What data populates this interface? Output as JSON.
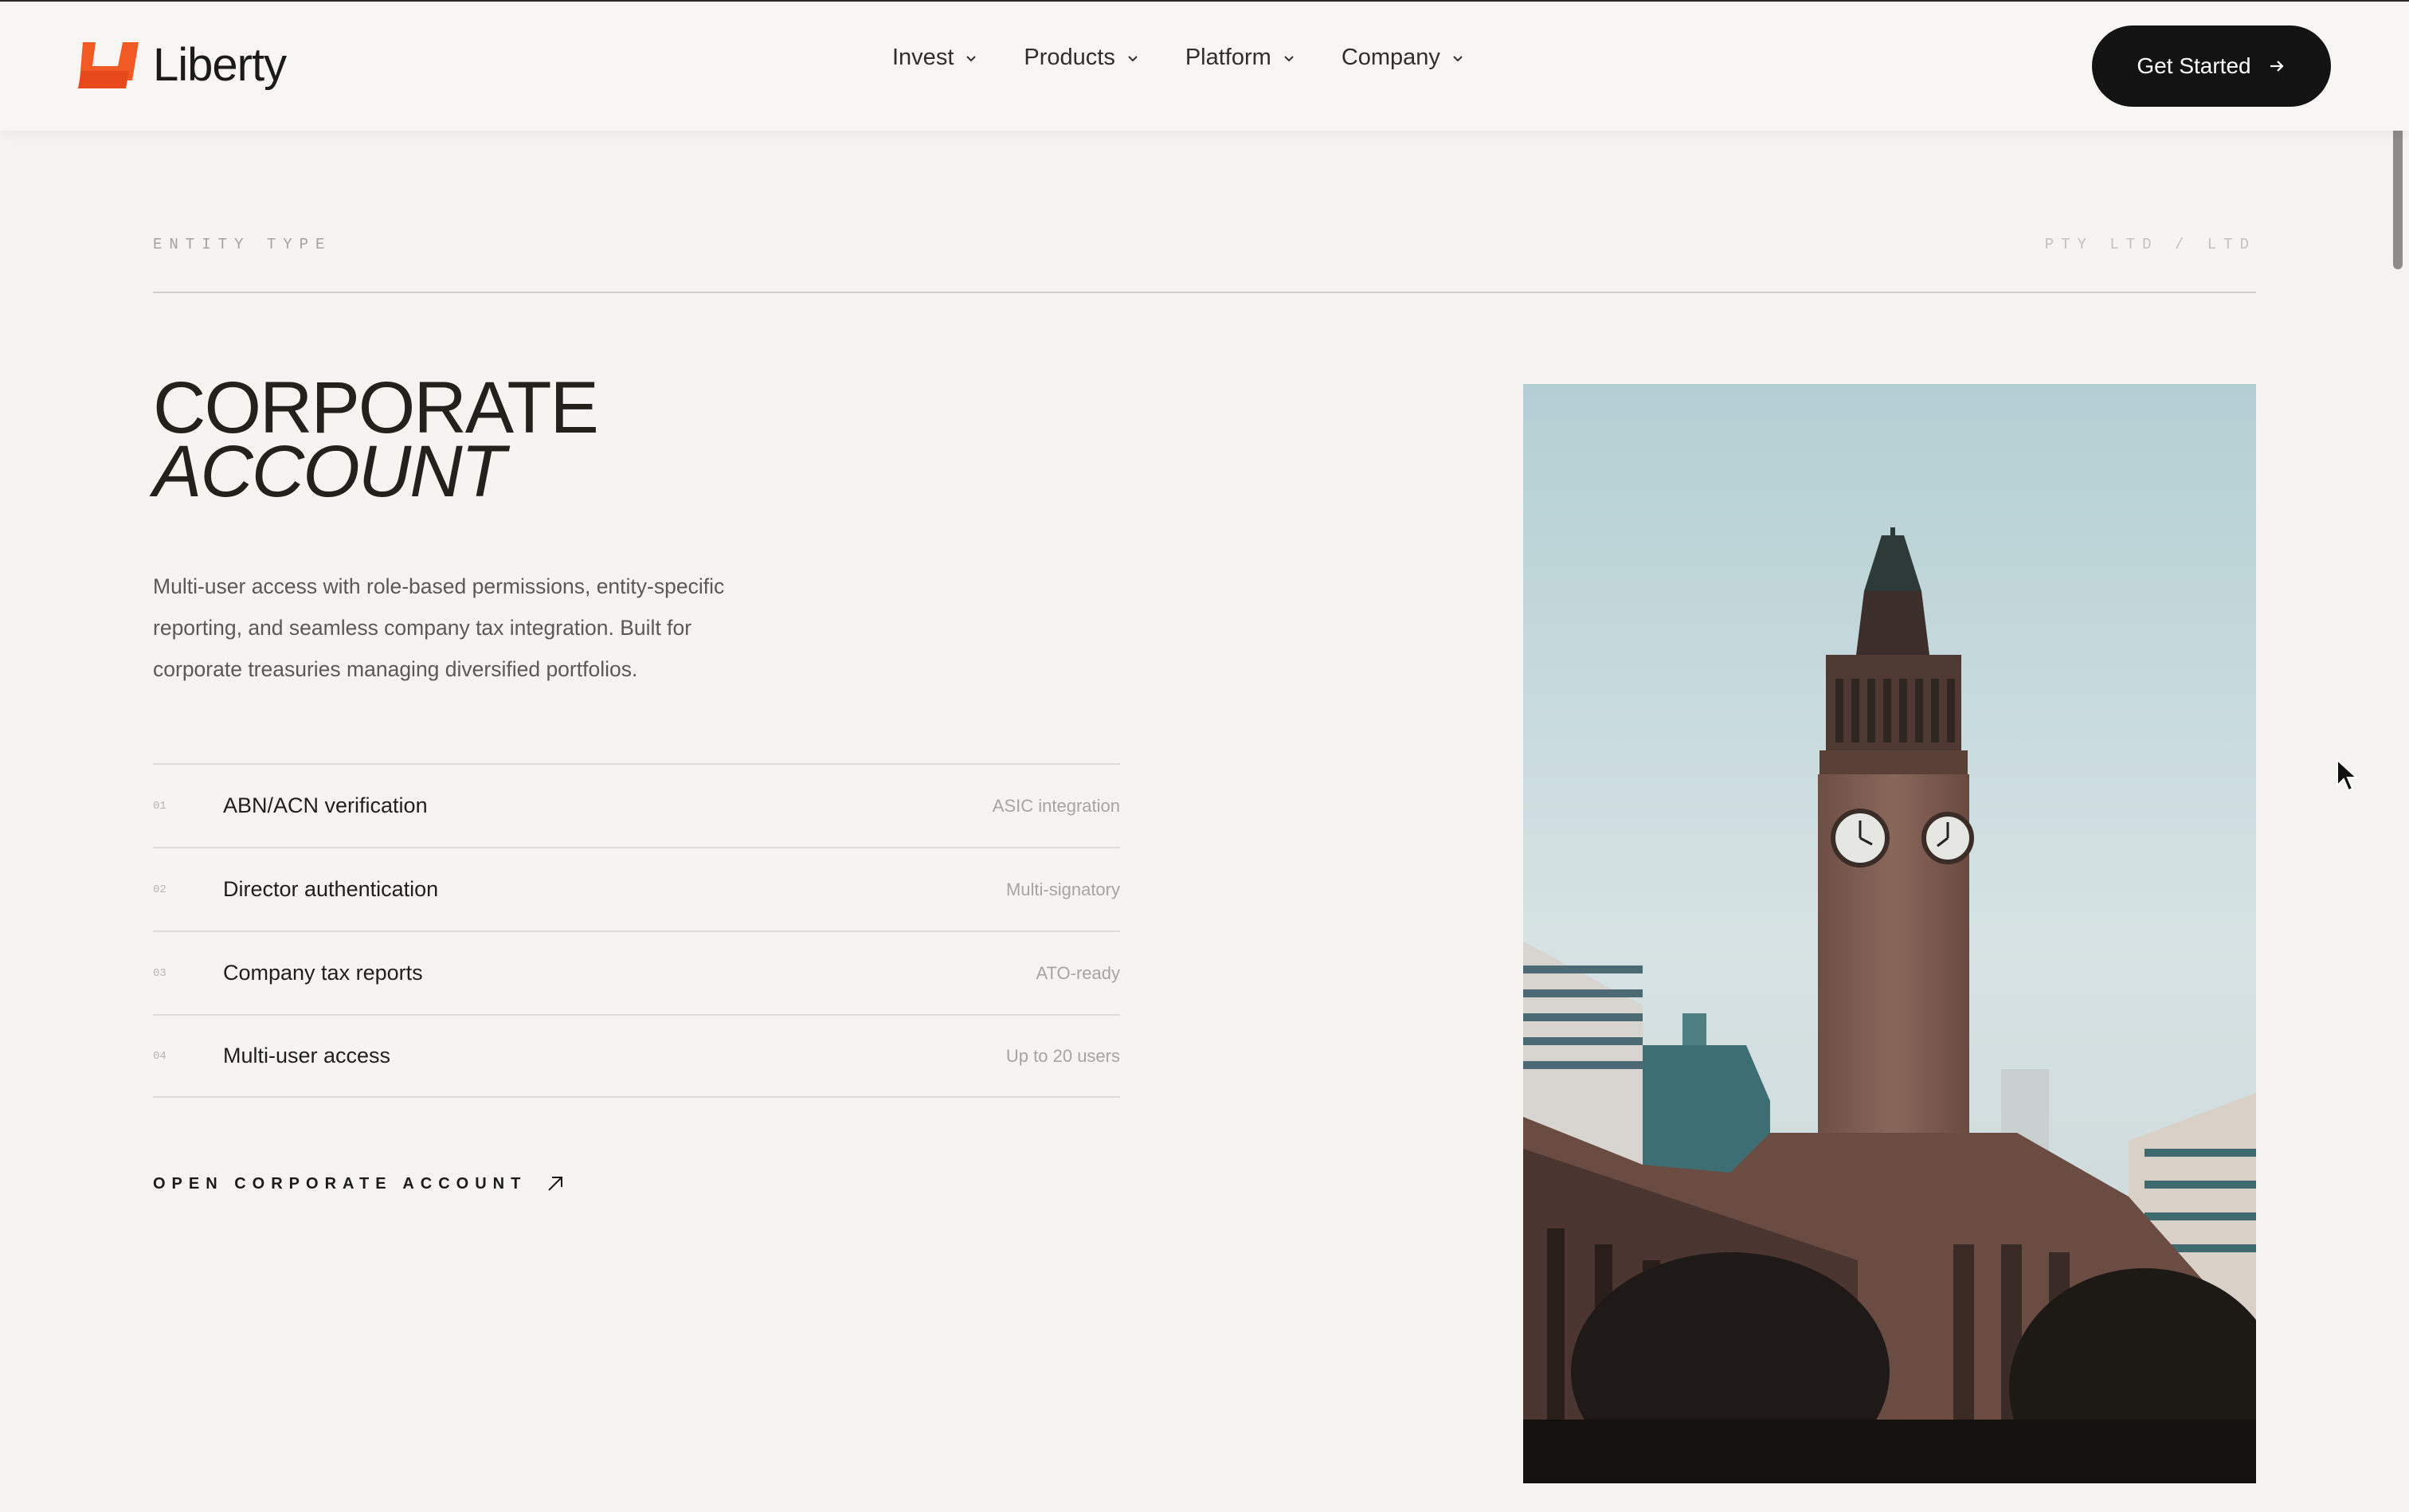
{
  "brand": {
    "name": "Liberty",
    "accent": "#f15a24"
  },
  "nav": {
    "items": [
      {
        "label": "Invest",
        "icon": "chevron-down-icon"
      },
      {
        "label": "Products",
        "icon": "chevron-down-icon"
      },
      {
        "label": "Platform",
        "icon": "chevron-down-icon"
      },
      {
        "label": "Company",
        "icon": "chevron-down-icon"
      }
    ],
    "cta_label": "Get Started",
    "cta_icon": "arrow-right-icon"
  },
  "section": {
    "label": "ENTITY TYPE",
    "types": "PTY LTD / LTD",
    "title_line1": "CORPORATE",
    "title_line2": "ACCOUNT",
    "description": "Multi-user access with role-based permissions, entity-specific reporting, and seamless company tax integration. Built for corporate treasuries managing diversified portfolios.",
    "features": [
      {
        "num": "01",
        "name": "ABN/ACN verification",
        "tag": "ASIC integration"
      },
      {
        "num": "02",
        "name": "Director authentication",
        "tag": "Multi-signatory"
      },
      {
        "num": "03",
        "name": "Company tax reports",
        "tag": "ATO-ready"
      },
      {
        "num": "04",
        "name": "Multi-user access",
        "tag": "Up to 20 users"
      }
    ],
    "link_label": "OPEN CORPORATE ACCOUNT",
    "link_icon": "arrow-up-right-icon"
  },
  "photo": {
    "subject": "clock-tower-photo"
  }
}
